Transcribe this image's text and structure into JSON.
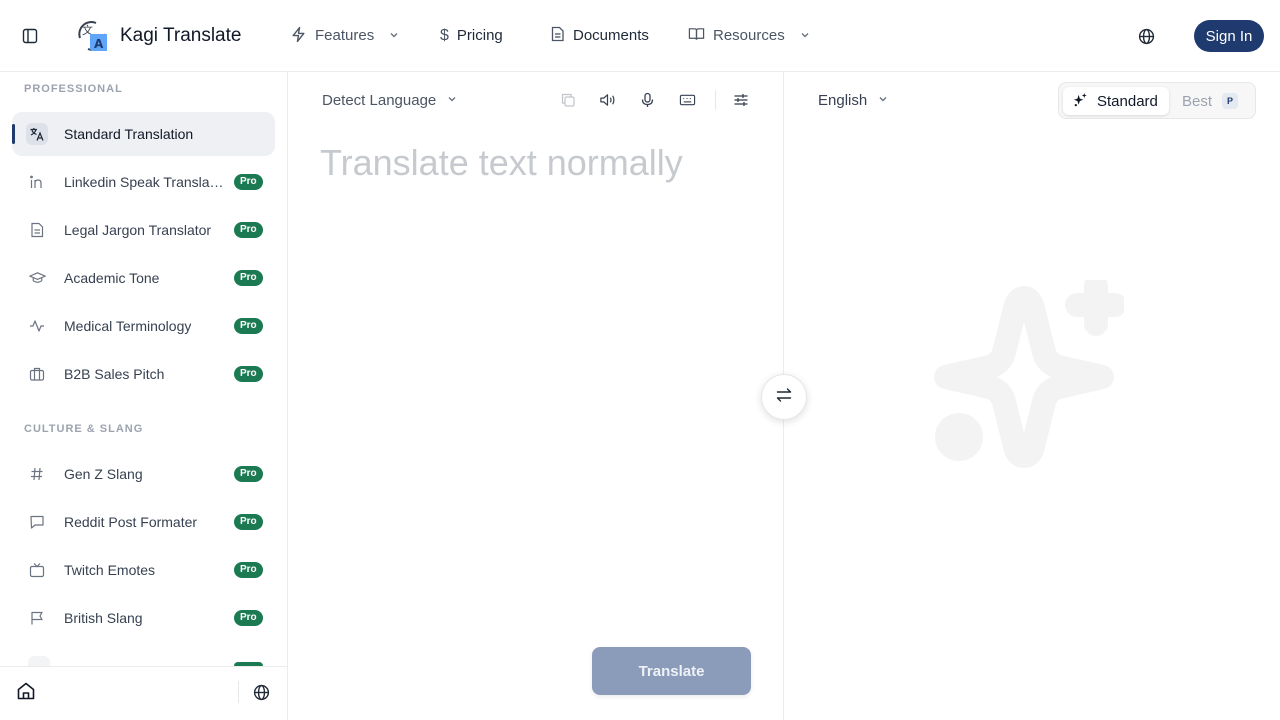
{
  "header": {
    "brand": "Kagi Translate",
    "nav": {
      "features": "Features",
      "pricing": "Pricing",
      "documents": "Documents",
      "resources": "Resources"
    },
    "sign_in": "Sign In"
  },
  "sidebar": {
    "sections": [
      {
        "title": "PROFESSIONAL",
        "items": [
          {
            "label": "Standard Translation",
            "icon": "translate-icon",
            "active": true
          },
          {
            "label": "Linkedin Speak Translator",
            "icon": "linkedin-icon",
            "badge": "Pro"
          },
          {
            "label": "Legal Jargon Translator",
            "icon": "document-icon",
            "badge": "Pro"
          },
          {
            "label": "Academic Tone",
            "icon": "graduation-cap-icon",
            "badge": "Pro"
          },
          {
            "label": "Medical Terminology",
            "icon": "heartbeat-icon",
            "badge": "Pro"
          },
          {
            "label": "B2B Sales Pitch",
            "icon": "briefcase-icon",
            "badge": "Pro"
          }
        ]
      },
      {
        "title": "CULTURE & SLANG",
        "items": [
          {
            "label": "Gen Z Slang",
            "icon": "hashtag-icon",
            "badge": "Pro"
          },
          {
            "label": "Reddit Post Formater",
            "icon": "chat-bubble-icon",
            "badge": "Pro"
          },
          {
            "label": "Twitch Emotes",
            "icon": "tv-icon",
            "badge": "Pro"
          },
          {
            "label": "British Slang",
            "icon": "flag-icon",
            "badge": "Pro"
          }
        ]
      }
    ]
  },
  "source": {
    "language": "Detect Language",
    "placeholder": "Translate text normally",
    "value": "",
    "translate_label": "Translate"
  },
  "target": {
    "language": "English",
    "modes": {
      "standard": "Standard",
      "best": "Best",
      "best_badge": "P"
    }
  },
  "colors": {
    "brand": "#1e3a6e",
    "pro_badge": "#1b7a52",
    "translate_button": "#8b9cbb"
  }
}
